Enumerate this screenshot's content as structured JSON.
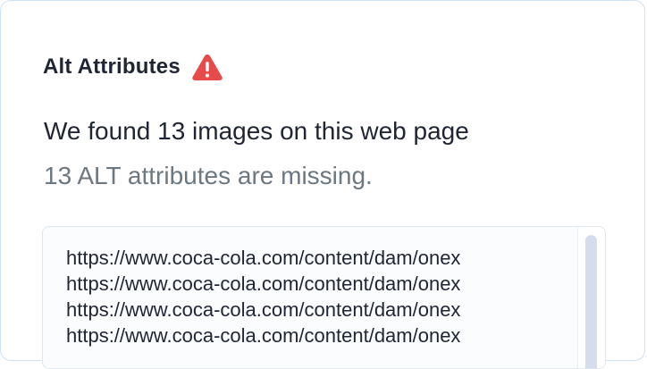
{
  "panel": {
    "title": "Alt Attributes",
    "status_icon": "warning-icon",
    "status_color": "#e54b4b",
    "found_text": "We found 13 images on this web page",
    "missing_text": "13 ALT attributes are missing.",
    "urls": [
      "https://www.coca-cola.com/content/dam/onex",
      "https://www.coca-cola.com/content/dam/onex",
      "https://www.coca-cola.com/content/dam/onex",
      "https://www.coca-cola.com/content/dam/onex"
    ]
  }
}
